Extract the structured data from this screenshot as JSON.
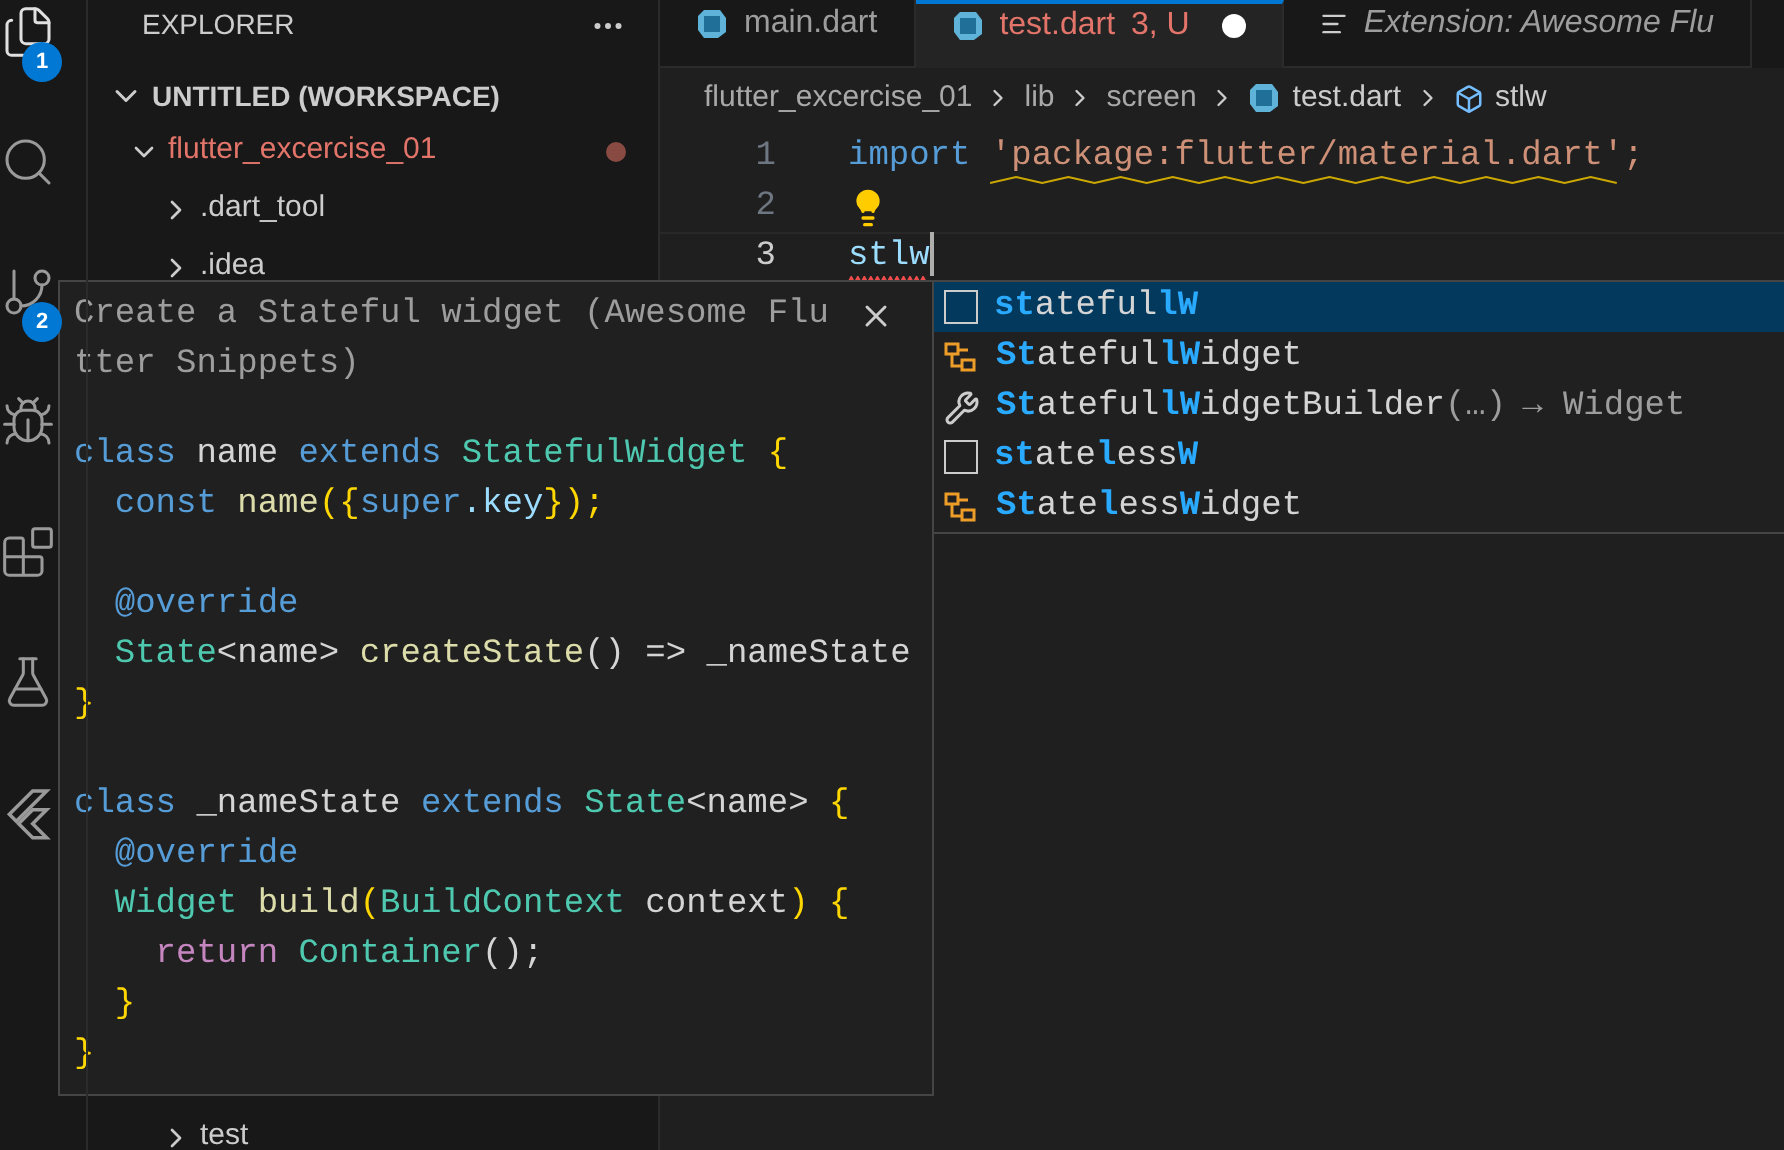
{
  "activity_bar": [
    {
      "kind": "files",
      "badge": "1",
      "selected": true
    },
    {
      "kind": "search",
      "selected": false
    },
    {
      "kind": "source-control",
      "badge": "2",
      "selected": false
    },
    {
      "kind": "run",
      "selected": false
    },
    {
      "kind": "extensions",
      "selected": false
    },
    {
      "kind": "testing",
      "selected": false
    },
    {
      "kind": "flutter",
      "selected": false
    }
  ],
  "sidebar": {
    "title": "EXPLORER",
    "workspace": {
      "label": "UNTITLED (WORKSPACE)",
      "expanded": true
    },
    "tree": [
      {
        "label": "flutter_excercise_01",
        "expanded": true,
        "modified": true,
        "children": [
          {
            "label": ".dart_tool",
            "expanded": false
          },
          {
            "label": ".idea",
            "expanded": false
          },
          {
            "label": "test",
            "expanded": false
          }
        ]
      }
    ]
  },
  "tabs": [
    {
      "label": "main.dart",
      "kind": "dart",
      "selected": false
    },
    {
      "label": "test.dart",
      "status": "3, U",
      "dirty": true,
      "kind": "dart",
      "selected": true
    },
    {
      "label": "Extension: Awesome Flu",
      "kind": "preview",
      "selected": false
    }
  ],
  "breadcrumbs": [
    {
      "label": "flutter_excercise_01"
    },
    {
      "label": "lib"
    },
    {
      "label": "screen"
    },
    {
      "label": "test.dart",
      "kind": "dart"
    },
    {
      "label": "stlw",
      "kind": "symbol"
    }
  ],
  "editor_lines": [
    {
      "number": "1",
      "current": false,
      "tokens": [
        {
          "text": "import ",
          "kind": "keyword"
        },
        {
          "text": "'package:flutter/material.dart';",
          "kind": "string",
          "warning": true
        }
      ]
    },
    {
      "number": "2",
      "current": false,
      "lightbulb": true
    },
    {
      "number": "3",
      "current": true,
      "tokens": [
        {
          "text": "stlw",
          "kind": "variable",
          "error": true
        }
      ]
    }
  ],
  "suggestions": [
    {
      "kind": "snippet",
      "selected": true,
      "parts": [
        {
          "text": "st",
          "match": true
        },
        {
          "text": "ateful",
          "match": false
        },
        {
          "text": "lW",
          "match": true
        }
      ]
    },
    {
      "kind": "class",
      "selected": false,
      "parts": [
        {
          "text": "St",
          "match": true
        },
        {
          "text": "ateful",
          "match": false
        },
        {
          "text": "lW",
          "match": true
        },
        {
          "text": "idget",
          "match": false
        }
      ]
    },
    {
      "kind": "constructor",
      "selected": false,
      "parts": [
        {
          "text": "St",
          "match": true
        },
        {
          "text": "ateful",
          "match": false
        },
        {
          "text": "lW",
          "match": true
        },
        {
          "text": "idgetBuilder",
          "match": false
        }
      ],
      "signature": "(…)",
      "detail": "→ Widget"
    },
    {
      "kind": "snippet",
      "selected": false,
      "parts": [
        {
          "text": "st",
          "match": true
        },
        {
          "text": "ate",
          "match": false
        },
        {
          "text": "l",
          "match": true
        },
        {
          "text": "ess",
          "match": false
        },
        {
          "text": "W",
          "match": true
        }
      ]
    },
    {
      "kind": "class",
      "selected": false,
      "parts": [
        {
          "text": "St",
          "match": true
        },
        {
          "text": "ate",
          "match": false
        },
        {
          "text": "l",
          "match": true
        },
        {
          "text": "ess",
          "match": false
        },
        {
          "text": "W",
          "match": true
        },
        {
          "text": "idget",
          "match": false
        }
      ]
    }
  ],
  "details": {
    "title": "Create a Stateful widget (Awesome Flutter Snippets)",
    "code": [
      {
        "kind": "code",
        "tokens": [
          {
            "text": "class ",
            "kind": "keyword"
          },
          {
            "text": "name ",
            "kind": "plain"
          },
          {
            "text": "extends ",
            "kind": "keyword"
          },
          {
            "text": "StatefulWidget ",
            "kind": "type"
          },
          {
            "text": "{",
            "kind": "bracket"
          }
        ]
      },
      {
        "kind": "code",
        "tokens": [
          {
            "text": "  const ",
            "kind": "keyword"
          },
          {
            "text": "name",
            "kind": "func"
          },
          {
            "text": "({",
            "kind": "bracket"
          },
          {
            "text": "super",
            "kind": "keyword"
          },
          {
            "text": ".key",
            "kind": "variable"
          },
          {
            "text": "});",
            "kind": "bracket"
          }
        ]
      },
      {
        "kind": "blank"
      },
      {
        "kind": "code",
        "tokens": [
          {
            "text": "  @override",
            "kind": "keyword"
          }
        ]
      },
      {
        "kind": "code",
        "tokens": [
          {
            "text": "  State",
            "kind": "type"
          },
          {
            "text": "<name> ",
            "kind": "plain"
          },
          {
            "text": "createState",
            "kind": "func"
          },
          {
            "text": "() => _nameState",
            "kind": "plain"
          }
        ]
      },
      {
        "kind": "code",
        "tokens": [
          {
            "text": "}",
            "kind": "bracket"
          }
        ]
      },
      {
        "kind": "blank"
      },
      {
        "kind": "code",
        "tokens": [
          {
            "text": "class ",
            "kind": "keyword"
          },
          {
            "text": "_nameState ",
            "kind": "plain"
          },
          {
            "text": "extends ",
            "kind": "keyword"
          },
          {
            "text": "State",
            "kind": "type"
          },
          {
            "text": "<name> ",
            "kind": "plain"
          },
          {
            "text": "{",
            "kind": "bracket"
          }
        ]
      },
      {
        "kind": "code",
        "tokens": [
          {
            "text": "  @override",
            "kind": "keyword"
          }
        ]
      },
      {
        "kind": "code",
        "tokens": [
          {
            "text": "  Widget ",
            "kind": "type"
          },
          {
            "text": "build",
            "kind": "func"
          },
          {
            "text": "(",
            "kind": "bracket"
          },
          {
            "text": "BuildContext",
            "kind": "type"
          },
          {
            "text": " context",
            "kind": "plain"
          },
          {
            "text": ") {",
            "kind": "bracket"
          }
        ]
      },
      {
        "kind": "code",
        "tokens": [
          {
            "text": "    return ",
            "kind": "control"
          },
          {
            "text": "Container",
            "kind": "type"
          },
          {
            "text": "();",
            "kind": "plain"
          }
        ]
      },
      {
        "kind": "code",
        "tokens": [
          {
            "text": "  }",
            "kind": "bracket"
          }
        ]
      },
      {
        "kind": "code",
        "tokens": [
          {
            "text": "}",
            "kind": "bracket"
          }
        ]
      }
    ]
  }
}
